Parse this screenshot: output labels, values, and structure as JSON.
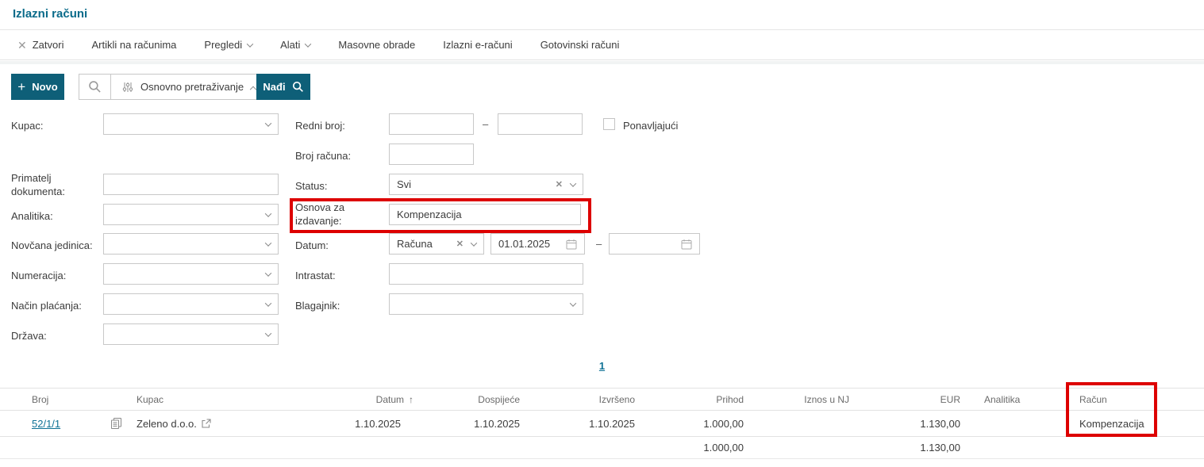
{
  "page": {
    "title": "Izlazni računi"
  },
  "toolbar": {
    "items": [
      {
        "label": "Zatvori"
      },
      {
        "label": "Artikli na računima"
      },
      {
        "label": "Pregledi"
      },
      {
        "label": "Alati"
      },
      {
        "label": "Masovne obrade"
      },
      {
        "label": "Izlazni e-računi"
      },
      {
        "label": "Gotovinski računi"
      }
    ]
  },
  "actions": {
    "new_button": "Novo",
    "search_mode": "Osnovno pretraživanje",
    "find_button": "Nađi"
  },
  "filters": {
    "range_dash": "–",
    "left": {
      "kupac": {
        "label": "Kupac:",
        "value": ""
      },
      "primatelj": {
        "label": "Primatelj dokumenta:",
        "value": ""
      },
      "analitika": {
        "label": "Analitika:",
        "value": ""
      },
      "novcana_jedinica": {
        "label": "Novčana jedinica:",
        "value": ""
      },
      "numeracija": {
        "label": "Numeracija:",
        "value": ""
      },
      "nacin_placanja": {
        "label": "Način plaćanja:",
        "value": ""
      },
      "drzava": {
        "label": "Država:",
        "value": ""
      }
    },
    "right": {
      "redni_broj": {
        "label": "Redni broj:",
        "from": "",
        "to": ""
      },
      "ponavljajuci": {
        "label": "Ponavljajući",
        "checked": false
      },
      "broj_racuna": {
        "label": "Broj računa:",
        "value": ""
      },
      "status": {
        "label": "Status:",
        "value": "Svi"
      },
      "osnova": {
        "label": "Osnova za izdavanje:",
        "value": "Kompenzacija"
      },
      "datum": {
        "label": "Datum:",
        "type_value": "Računa",
        "from": "01.01.2025",
        "to": ""
      },
      "intrastat": {
        "label": "Intrastat:",
        "value": ""
      },
      "blagajnik": {
        "label": "Blagajnik:",
        "value": ""
      }
    }
  },
  "pagination": {
    "page": "1"
  },
  "table": {
    "headers": {
      "broj": "Broj",
      "kupac": "Kupac",
      "datum": "Datum",
      "dospijece": "Dospijeće",
      "izvrseno": "Izvršeno",
      "prihod": "Prihod",
      "iznos_u_nj": "Iznos u NJ",
      "eur": "EUR",
      "analitika": "Analitika",
      "racun": "Račun"
    },
    "sort": {
      "column": "Datum",
      "direction": "asc"
    },
    "rows": [
      {
        "broj": "52/1/1",
        "kupac": "Zeleno d.o.o.",
        "datum": "1.10.2025",
        "dospijece": "1.10.2025",
        "izvrseno": "1.10.2025",
        "prihod": "1.000,00",
        "iznos_u_nj": "",
        "eur": "1.130,00",
        "analitika": "",
        "racun": "Kompenzacija"
      }
    ],
    "totals": {
      "prihod": "1.000,00",
      "eur": "1.130,00"
    }
  },
  "colors": {
    "accent": "#0e5f78",
    "title": "#0a6b8a",
    "link": "#0e7195",
    "annotation_red": "#dd0000"
  }
}
